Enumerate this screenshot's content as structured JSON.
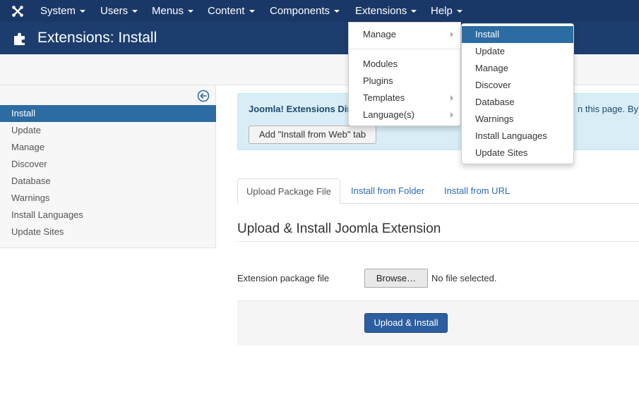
{
  "navbar": {
    "logo_icon": "joomla-logo-icon",
    "items": [
      {
        "label": "System"
      },
      {
        "label": "Users"
      },
      {
        "label": "Menus"
      },
      {
        "label": "Content"
      },
      {
        "label": "Components"
      },
      {
        "label": "Extensions"
      },
      {
        "label": "Help"
      }
    ]
  },
  "header": {
    "icon": "puzzle-icon",
    "title": "Extensions: Install"
  },
  "sidebar": {
    "toggle_icon": "arrow-left-circle-icon",
    "items": [
      {
        "label": "Install",
        "active": true
      },
      {
        "label": "Update"
      },
      {
        "label": "Manage"
      },
      {
        "label": "Discover"
      },
      {
        "label": "Database"
      },
      {
        "label": "Warnings"
      },
      {
        "label": "Install Languages"
      },
      {
        "label": "Update Sites"
      }
    ]
  },
  "alert": {
    "title": "Joomla! Extensions Dir",
    "text_tail": "n this page. By s",
    "button_label": "Add \"Install from Web\" tab"
  },
  "tabs": [
    {
      "label": "Upload Package File",
      "active": true
    },
    {
      "label": "Install from Folder"
    },
    {
      "label": "Install from URL"
    }
  ],
  "main": {
    "section_title": "Upload & Install Joomla Extension",
    "field_label": "Extension package file",
    "browse_label": "Browse…",
    "file_status": "No file selected.",
    "upload_label": "Upload & Install"
  },
  "extensions_menu": {
    "items": [
      {
        "label": "Manage"
      },
      {
        "label": "Modules"
      },
      {
        "label": "Plugins"
      },
      {
        "label": "Templates"
      },
      {
        "label": "Language(s)"
      }
    ]
  },
  "manage_submenu": {
    "items": [
      {
        "label": "Install",
        "active": true
      },
      {
        "label": "Update"
      },
      {
        "label": "Manage"
      },
      {
        "label": "Discover"
      },
      {
        "label": "Database"
      },
      {
        "label": "Warnings"
      },
      {
        "label": "Install Languages"
      },
      {
        "label": "Update Sites"
      }
    ]
  },
  "colors": {
    "navbar": "#1a3867",
    "header": "#1c3d6e",
    "accent": "#2d6ca2",
    "link": "#2a69b8",
    "alert_bg": "#d9edf7"
  }
}
